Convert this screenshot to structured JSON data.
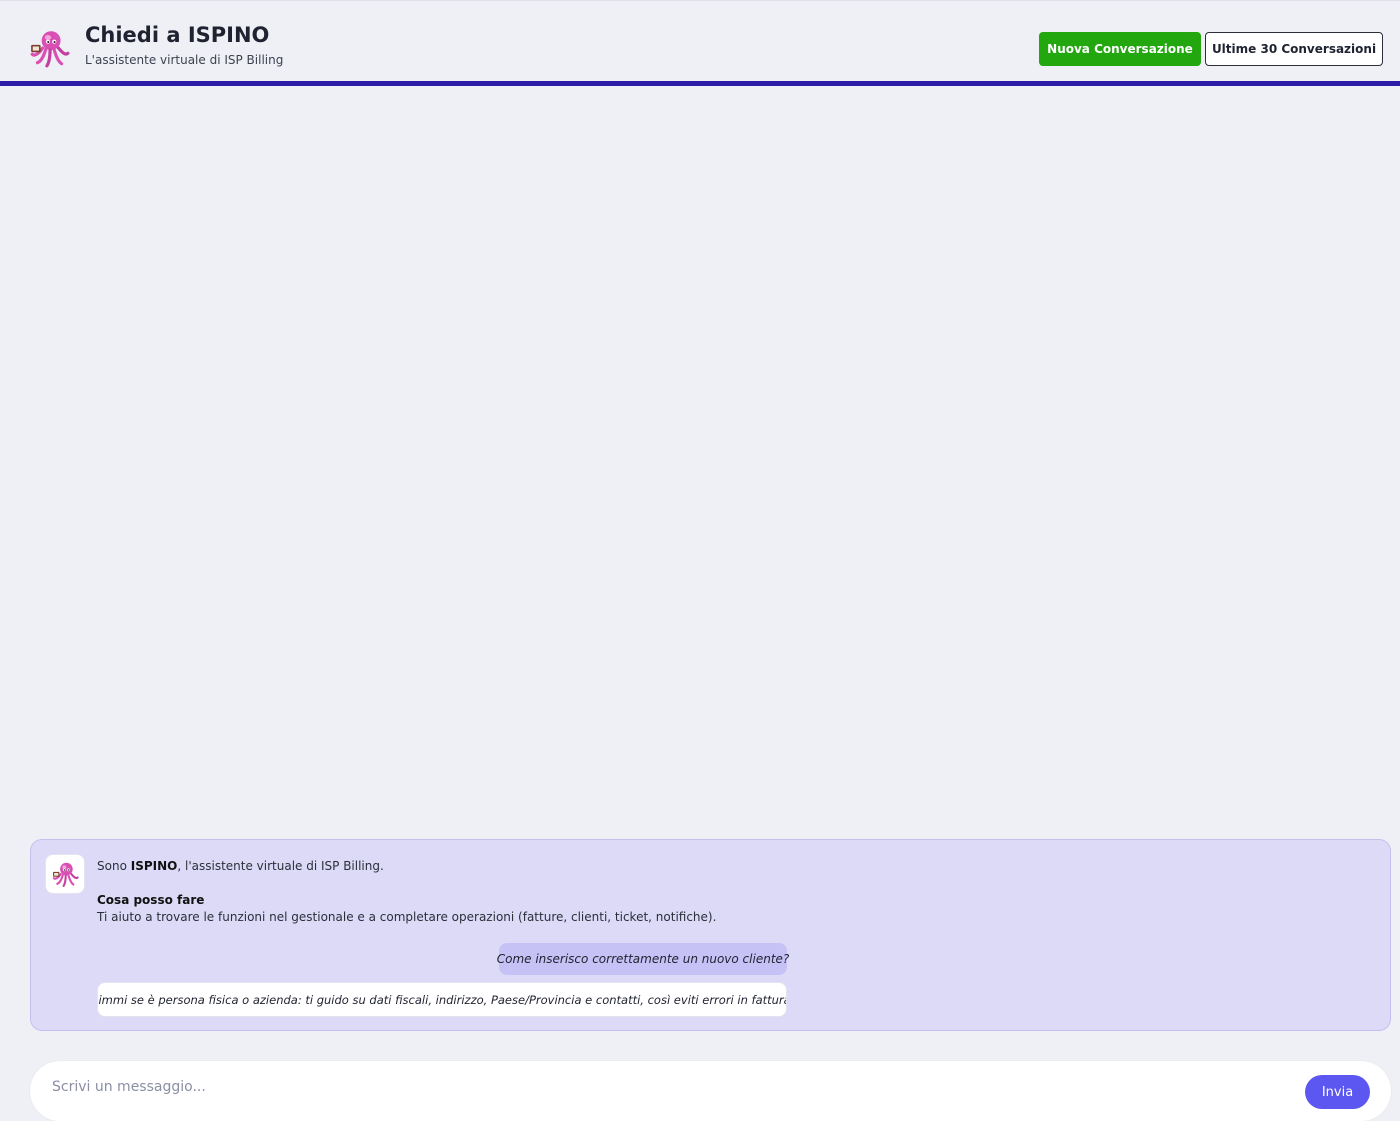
{
  "header": {
    "logo_icon": "octopus-icon",
    "title": "Chiedi a ISPINO",
    "subtitle": "L'assistente virtuale di ISP Billing",
    "new_conversation_label": "Nuova Conversazione",
    "history_label": "Ultime 30 Conversazioni"
  },
  "chat": {
    "avatar_icon": "octopus-icon",
    "intro_prefix": "Sono ",
    "intro_name": "ISPINO",
    "intro_suffix": ", l'assistente virtuale di ISP Billing.",
    "section_title": "Cosa posso fare",
    "section_text": "Ti aiuto a trovare le funzioni nel gestionale e a completare operazioni (fatture, clienti, ticket, notifiche).",
    "messages": [
      {
        "role": "user",
        "text": "Come inserisco correttamente un nuovo cliente?"
      },
      {
        "role": "assistant",
        "text": "Dimmi se è persona fisica o azienda: ti guido su dati fiscali, indirizzo, Paese/Provincia e contatti, così eviti errori in fattura."
      }
    ]
  },
  "composer": {
    "placeholder": "Scrivi un messaggio...",
    "send_label": "Invia"
  },
  "colors": {
    "header_accent": "#2c1ca8",
    "new_button": "#22a70f",
    "send_button": "#5b57f0",
    "panel_bg": "#dcdaf7",
    "user_bubble": "#c7c2f6",
    "octopus": "#d94fb4"
  }
}
